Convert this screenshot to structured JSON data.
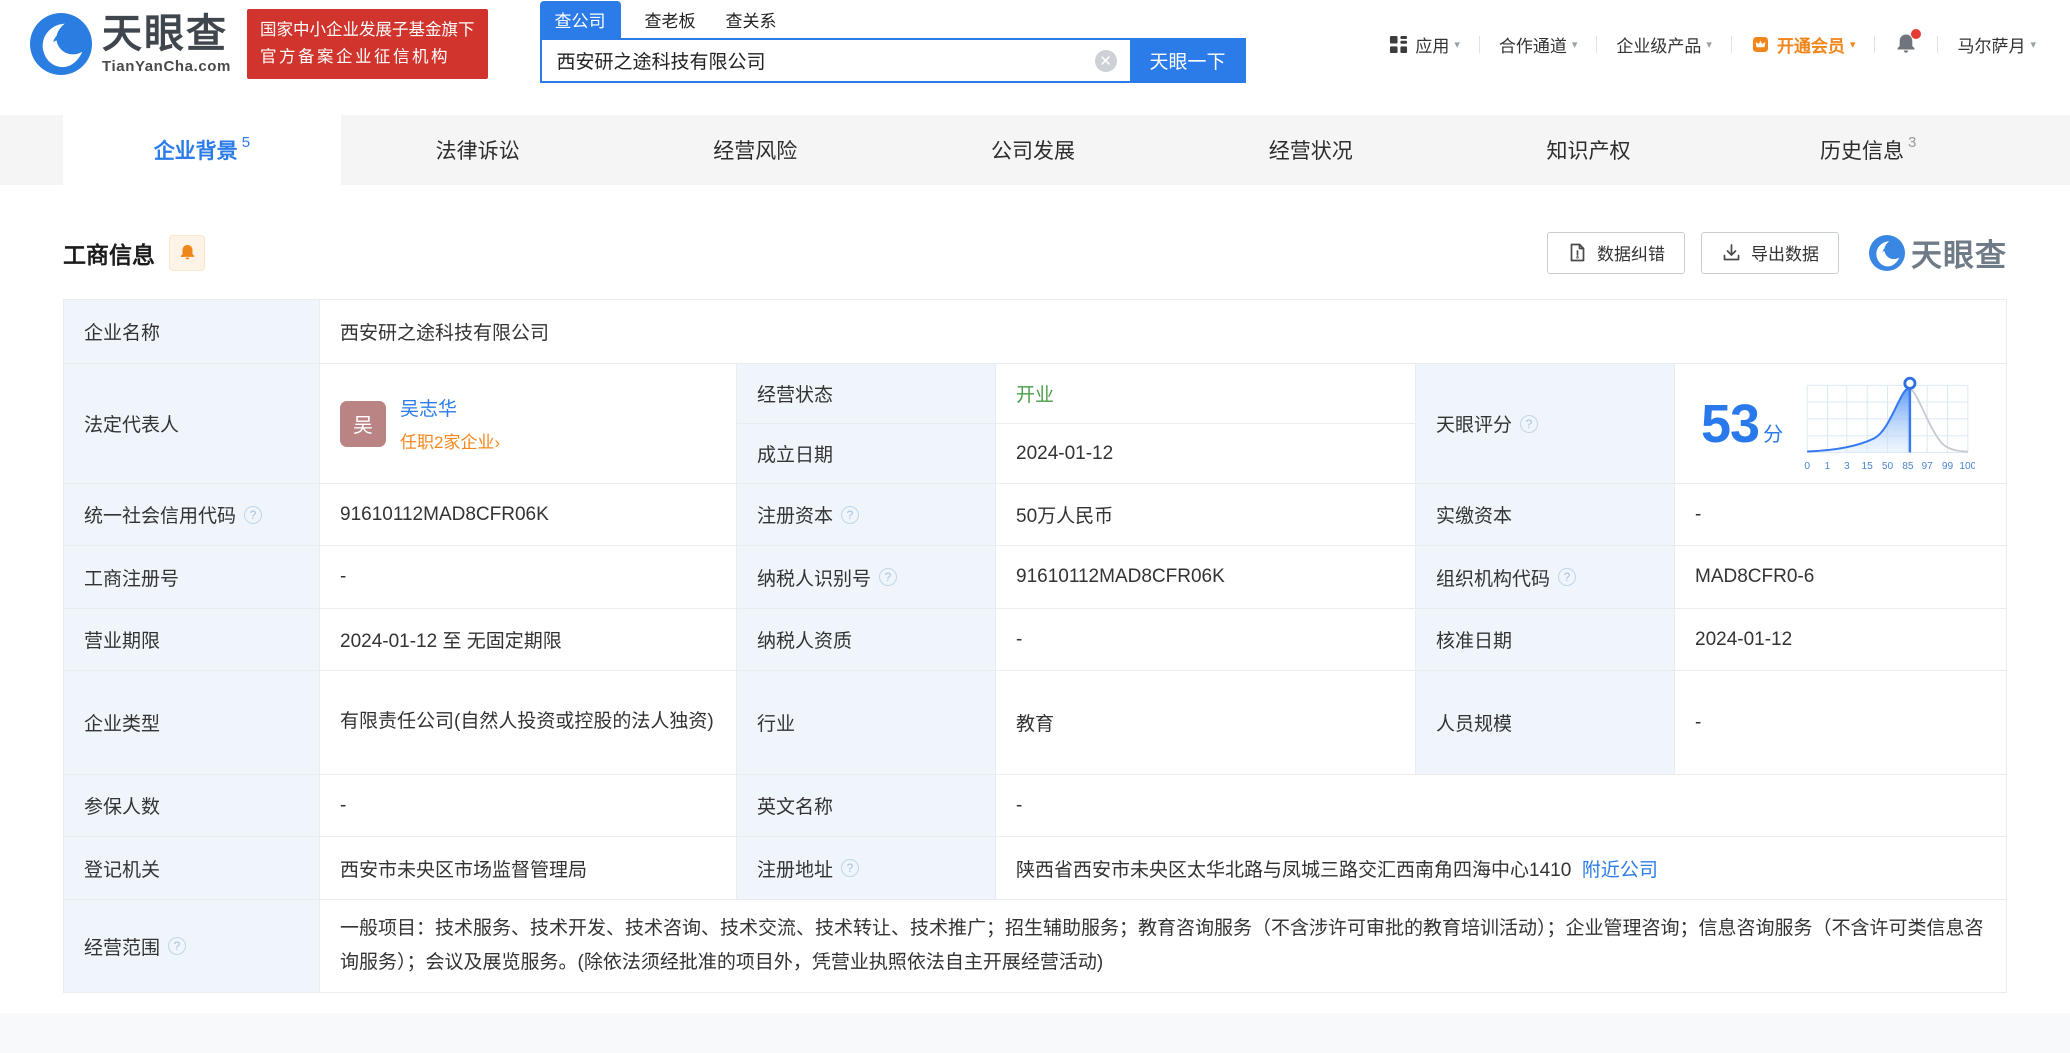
{
  "header": {
    "logo": {
      "title": "天眼查",
      "domain": "TianYanCha.com"
    },
    "badge": {
      "line1": "国家中小企业发展子基金旗下",
      "line2": "官方备案企业征信机构"
    },
    "search": {
      "tabs": [
        {
          "label": "查公司",
          "active": true
        },
        {
          "label": "查老板",
          "active": false
        },
        {
          "label": "查关系",
          "active": false
        }
      ],
      "value": "西安研之途科技有限公司",
      "button": "天眼一下"
    },
    "nav": {
      "apps": "应用",
      "cooperation": "合作通道",
      "enterprise": "企业级产品",
      "vip": "开通会员",
      "user": "马尔萨月"
    }
  },
  "tabs": [
    {
      "label": "企业背景",
      "count": "5",
      "active": true
    },
    {
      "label": "法律诉讼"
    },
    {
      "label": "经营风险"
    },
    {
      "label": "公司发展"
    },
    {
      "label": "经营状况"
    },
    {
      "label": "知识产权"
    },
    {
      "label": "历史信息",
      "count": "3"
    }
  ],
  "section": {
    "title": "工商信息",
    "correction": "数据纠错",
    "export": "导出数据",
    "watermark": "天眼查"
  },
  "info": {
    "company_name": {
      "label": "企业名称",
      "value": "西安研之途科技有限公司"
    },
    "legal_rep": {
      "label": "法定代表人",
      "name": "吴志华",
      "avatar": "吴",
      "link": "任职2家企业",
      "link_arrow": "›"
    },
    "status": {
      "label": "经营状态",
      "value": "开业"
    },
    "established": {
      "label": "成立日期",
      "value": "2024-01-12"
    },
    "score": {
      "label": "天眼评分"
    },
    "credit_code": {
      "label": "统一社会信用代码",
      "value": "91610112MAD8CFR06K"
    },
    "reg_capital": {
      "label": "注册资本",
      "value": "50万人民币"
    },
    "paid_capital": {
      "label": "实缴资本",
      "value": "-"
    },
    "reg_number": {
      "label": "工商注册号",
      "value": "-"
    },
    "taxpayer_id": {
      "label": "纳税人识别号",
      "value": "91610112MAD8CFR06K"
    },
    "org_code": {
      "label": "组织机构代码",
      "value": "MAD8CFR0-6"
    },
    "term": {
      "label": "营业期限",
      "value": "2024-01-12 至 无固定期限"
    },
    "taxpayer_qual": {
      "label": "纳税人资质",
      "value": "-"
    },
    "approval_date": {
      "label": "核准日期",
      "value": "2024-01-12"
    },
    "company_type": {
      "label": "企业类型",
      "value": "有限责任公司(自然人投资或控股的法人独资)"
    },
    "industry": {
      "label": "行业",
      "value": "教育"
    },
    "staff_size": {
      "label": "人员规模",
      "value": "-"
    },
    "insured_count": {
      "label": "参保人数",
      "value": "-"
    },
    "english_name": {
      "label": "英文名称",
      "value": "-"
    },
    "registry": {
      "label": "登记机关",
      "value": "西安市未央区市场监督管理局"
    },
    "address": {
      "label": "注册地址",
      "value": "陕西省西安市未央区太华北路与凤城三路交汇西南角四海中心1410",
      "link": "附近公司"
    },
    "scope": {
      "label": "经营范围",
      "value": "一般项目：技术服务、技术开发、技术咨询、技术交流、技术转让、技术推广；招生辅助服务；教育咨询服务（不含涉许可审批的教育培训活动）；企业管理咨询；信息咨询服务（不含许可类信息咨询服务）；会议及展览服务。(除依法须经批准的项目外，凭营业执照依法自主开展经营活动)"
    }
  },
  "chart_data": {
    "type": "area",
    "title": "天眼评分",
    "score": 53,
    "unit": "分",
    "x_ticks": [
      "0",
      "1",
      "3",
      "15",
      "50",
      "85",
      "97",
      "99",
      "100"
    ],
    "marker_at": 53,
    "xlabel": "",
    "ylabel": "",
    "description": "天眼评分percentile bell curve, blue filled area left of marker at score 53, grid on",
    "legend_position": "none"
  },
  "colors": {
    "brand_blue": "#2b7ce9",
    "score_blue": "#2979ec",
    "vip_orange": "#f08519",
    "link_orange": "#f5881d",
    "badge_red": "#d0342c",
    "status_green": "#4a9e4a",
    "label_cell_bg": "#eff5fa",
    "table_border": "#e9edf0",
    "tab_strip_bg": "#f5f5f6",
    "avatar_bg": "#bb8484"
  }
}
